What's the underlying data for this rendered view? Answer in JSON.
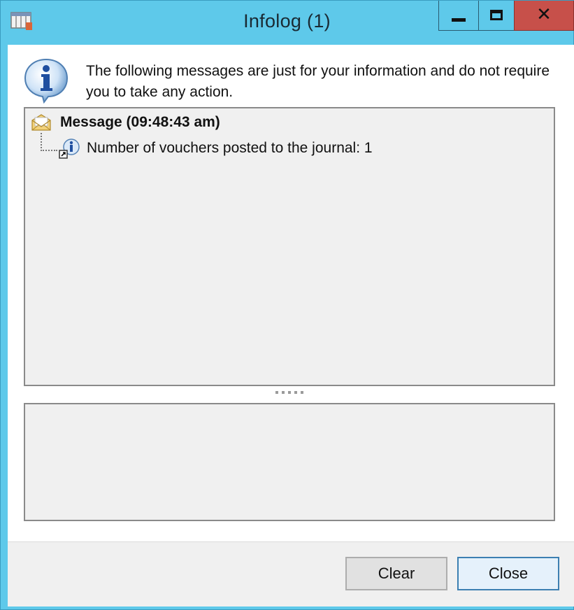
{
  "window": {
    "title": "Infolog (1)",
    "app_icon": "table-icon",
    "controls": {
      "minimize": "minimize-icon",
      "maximize": "maximize-icon",
      "close": "close-icon",
      "close_glyph": "✕"
    },
    "colors": {
      "titlebar": "#5ec9ea",
      "close_button": "#c7504a"
    }
  },
  "intro": {
    "icon": "info-icon",
    "text": "The following messages are just for your information and do not require you to take any action."
  },
  "tree": {
    "header": {
      "icon": "envelope-icon",
      "label": "Message (09:48:43 am)"
    },
    "items": [
      {
        "icon": "info-shortcut-icon",
        "text": "Number of vouchers posted to the journal: 1"
      }
    ]
  },
  "buttons": {
    "clear": "Clear",
    "close": "Close"
  }
}
